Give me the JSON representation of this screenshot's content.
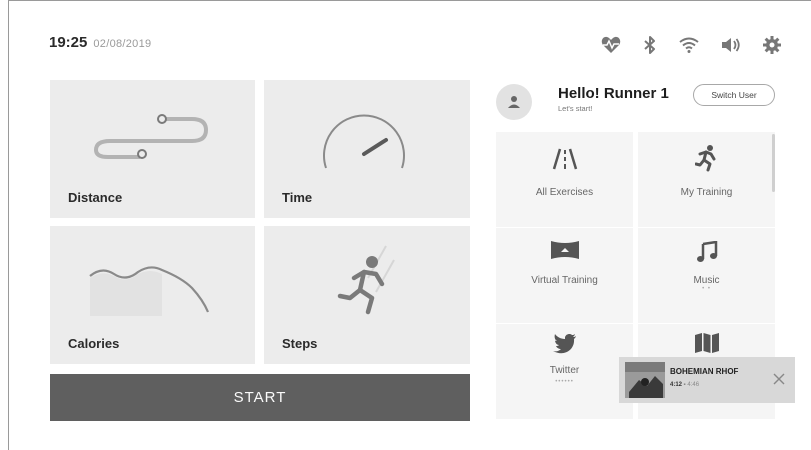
{
  "status": {
    "time": "19:25",
    "date": "02/08/2019"
  },
  "system_icons": [
    "heart-rate-icon",
    "bluetooth-icon",
    "wifi-icon",
    "volume-icon",
    "settings-gear-icon"
  ],
  "tiles": [
    {
      "label": "Distance",
      "icon": "route-icon"
    },
    {
      "label": "Time",
      "icon": "speedometer-icon"
    },
    {
      "label": "Calories",
      "icon": "wave-icon"
    },
    {
      "label": "Steps",
      "icon": "runner-icon"
    }
  ],
  "start_label": "START",
  "profile": {
    "greeting": "Hello! Runner 1",
    "subtitle": "Let's start!",
    "switch_label": "Switch User"
  },
  "apps": [
    {
      "label": "All Exercises",
      "icon": "road-icon"
    },
    {
      "label": "My Training",
      "icon": "running-person-icon"
    },
    {
      "label": "Virtual Training",
      "icon": "panorama-icon"
    },
    {
      "label": "Music",
      "icon": "music-note-icon"
    },
    {
      "label": "Twitter",
      "icon": "twitter-bird-icon"
    },
    {
      "label": "",
      "icon": "map-icon"
    }
  ],
  "now_playing": {
    "title": "BOHEMIAN RHOF",
    "position": "4:12",
    "duration": "4:46"
  },
  "colors": {
    "tile_bg": "#ececec",
    "start_bg": "#5f5f5f",
    "popup_bg": "#d8d8d8"
  }
}
